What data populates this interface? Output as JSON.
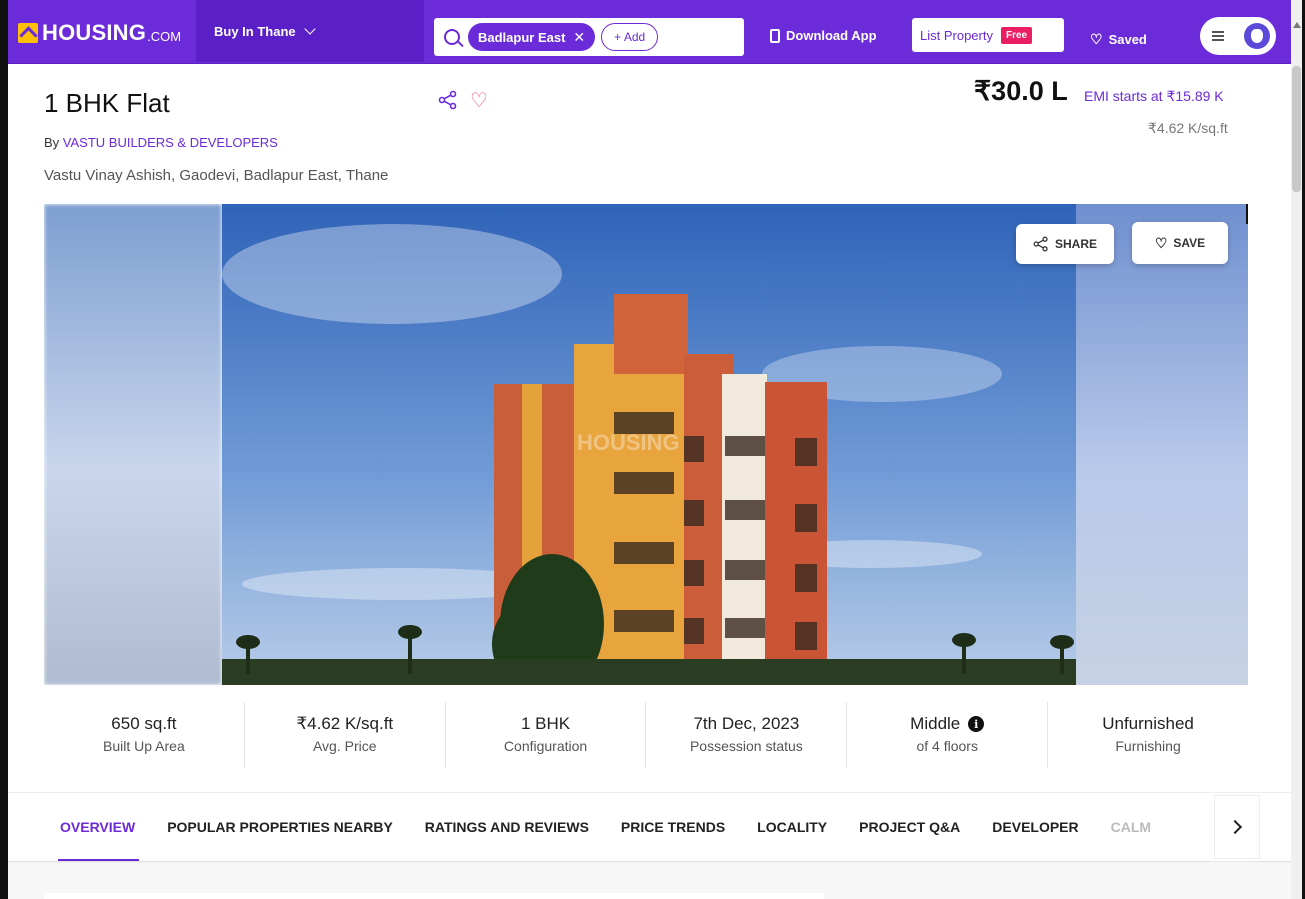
{
  "header": {
    "logo_text": "HOUSING",
    "logo_suffix": ".COM",
    "city_selector": "Buy In Thane",
    "search_chip": "Badlapur East",
    "add_button": "+ Add",
    "download_app": "Download App",
    "list_property": "List Property",
    "free_badge": "Free",
    "saved": "Saved"
  },
  "listing": {
    "title": "1 BHK Flat",
    "by_prefix": "By",
    "developer": "VASTU BUILDERS & DEVELOPERS",
    "address": "Vastu Vinay Ashish, Gaodevi, Badlapur East, Thane",
    "price": "₹30.0 L",
    "emi": "EMI starts at ₹15.89 K",
    "price_per_sqft": "₹4.62 K/sq.ft"
  },
  "hero": {
    "share_label": "SHARE",
    "save_label": "SAVE",
    "watermark": "HOUSING"
  },
  "stats": [
    {
      "value": "650 sq.ft",
      "label": "Built Up Area"
    },
    {
      "value": "₹4.62 K/sq.ft",
      "label": "Avg. Price"
    },
    {
      "value": "1 BHK",
      "label": "Configuration"
    },
    {
      "value": "7th Dec, 2023",
      "label": "Possession status"
    },
    {
      "value": "Middle",
      "label": "of 4 floors"
    },
    {
      "value": "Unfurnished",
      "label": "Furnishing"
    }
  ],
  "tabs": [
    "OVERVIEW",
    "POPULAR PROPERTIES NEARBY",
    "RATINGS AND REVIEWS",
    "PRICE TRENDS",
    "LOCALITY",
    "PROJECT Q&A",
    "DEVELOPER",
    "CALM"
  ],
  "colors": {
    "brand_purple": "#6c2bd9",
    "accent_yellow": "#ffc107",
    "free_pink": "#e91e63"
  }
}
